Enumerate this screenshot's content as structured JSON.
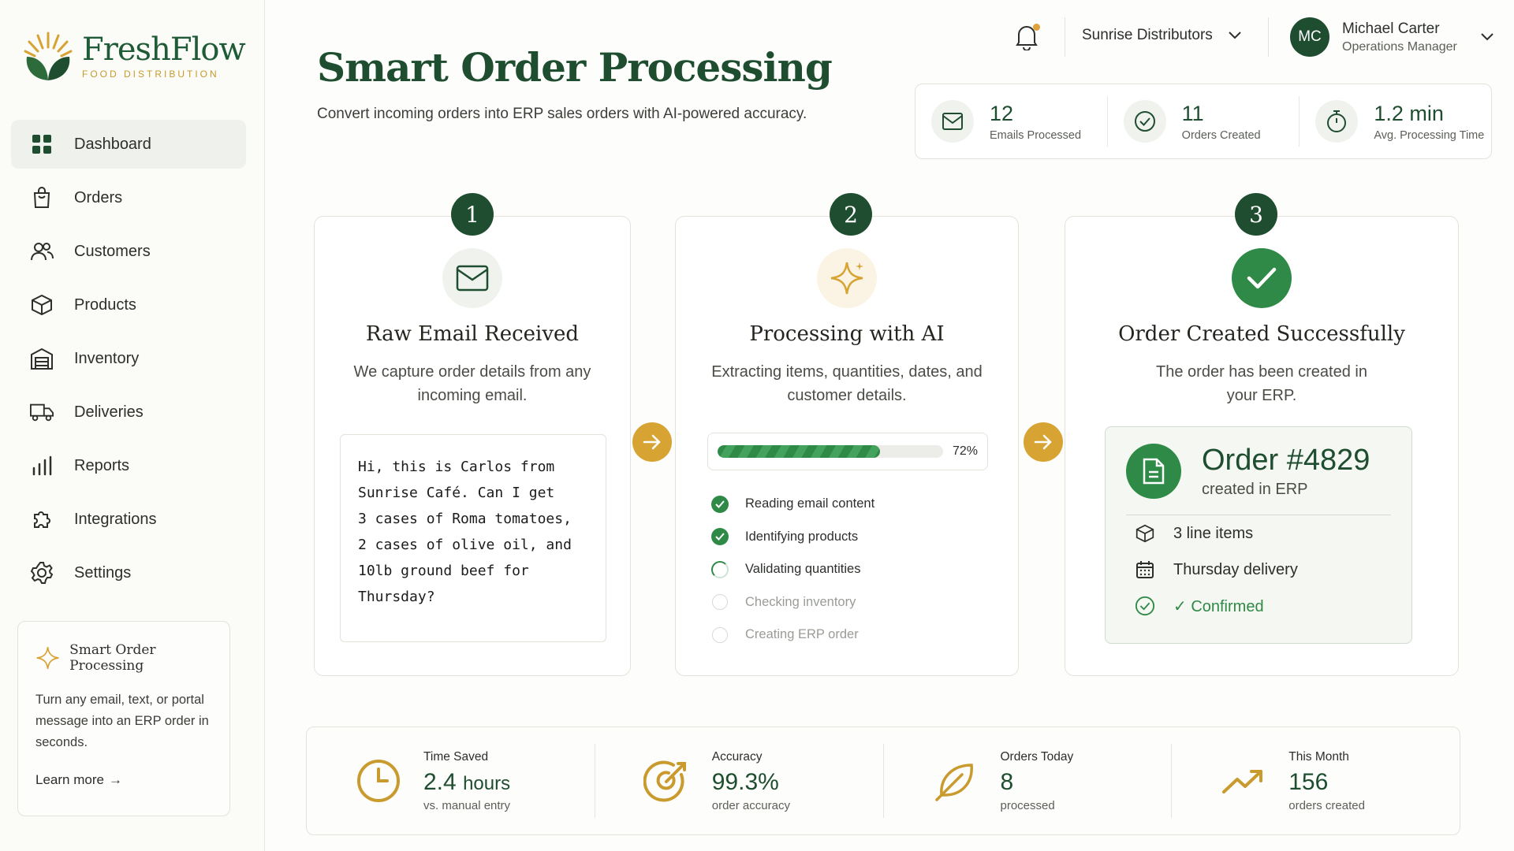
{
  "brand": {
    "name": "FreshFlow",
    "tagline": "FOOD DISTRIBUTION"
  },
  "sidebar": {
    "items": [
      {
        "label": "Dashboard",
        "icon": "dashboard-icon",
        "active": true
      },
      {
        "label": "Orders",
        "icon": "bag-icon"
      },
      {
        "label": "Customers",
        "icon": "users-icon"
      },
      {
        "label": "Products",
        "icon": "box-icon"
      },
      {
        "label": "Inventory",
        "icon": "warehouse-icon"
      },
      {
        "label": "Deliveries",
        "icon": "truck-icon"
      },
      {
        "label": "Reports",
        "icon": "bar-chart-icon"
      },
      {
        "label": "Integrations",
        "icon": "puzzle-icon"
      },
      {
        "label": "Settings",
        "icon": "gear-icon"
      }
    ],
    "promo": {
      "title": "Smart Order Processing",
      "body": "Turn any email, text, or portal message into an ERP order in seconds.",
      "link": "Learn more"
    }
  },
  "header": {
    "title": "Smart Order Processing",
    "subtitle": "Convert incoming orders into ERP sales orders with AI-powered accuracy.",
    "company": "Sunrise Distributors",
    "user": {
      "initials": "MC",
      "name": "Michael Carter",
      "role": "Operations Manager"
    }
  },
  "stats": [
    {
      "value": "12",
      "label": "Emails Processed",
      "icon": "mail-icon"
    },
    {
      "value": "11",
      "label": "Orders Created",
      "icon": "check-circle-icon"
    },
    {
      "value": "1.2 min",
      "label": "Avg. Processing Time",
      "icon": "stopwatch-icon"
    }
  ],
  "steps": [
    {
      "number": "1",
      "title": "Raw Email Received",
      "description": "We capture order details from any incoming email.",
      "email_text": "Hi, this is Carlos from\nSunrise Café. Can I get\n3 cases of Roma tomatoes,\n2 cases of olive oil, and\n10lb ground beef for\nThursday?"
    },
    {
      "number": "2",
      "title": "Processing with AI",
      "description": "Extracting items, quantities, dates, and customer details.",
      "progress_percent": 72,
      "progress_label": "72%",
      "tasks": [
        {
          "label": "Reading email content",
          "status": "done"
        },
        {
          "label": "Identifying products",
          "status": "done"
        },
        {
          "label": "Validating quantities",
          "status": "in-progress"
        },
        {
          "label": "Checking inventory",
          "status": "pending"
        },
        {
          "label": "Creating ERP order",
          "status": "pending"
        }
      ]
    },
    {
      "number": "3",
      "title": "Order Created Successfully",
      "description": "The order has been created in your ERP.",
      "order_number": "Order #4829",
      "order_sub": "created in ERP",
      "line_items": "3 line items",
      "delivery": "Thursday delivery",
      "status": "✓ Confirmed"
    }
  ],
  "metrics": [
    {
      "label": "Time Saved",
      "value": "2.4",
      "unit": "hours",
      "note": "vs. manual entry",
      "icon": "clock-icon"
    },
    {
      "label": "Accuracy",
      "value": "99.3%",
      "unit": "",
      "note": "order accuracy",
      "icon": "target-icon"
    },
    {
      "label": "Orders Today",
      "value": "8",
      "unit": "",
      "note": "processed",
      "icon": "leaf-icon"
    },
    {
      "label": "This Month",
      "value": "156",
      "unit": "",
      "note": "orders created",
      "icon": "trending-up-icon"
    }
  ],
  "colors": {
    "brand_green": "#1f4d30",
    "success": "#2e8a46",
    "accent_gold": "#d7a332"
  }
}
